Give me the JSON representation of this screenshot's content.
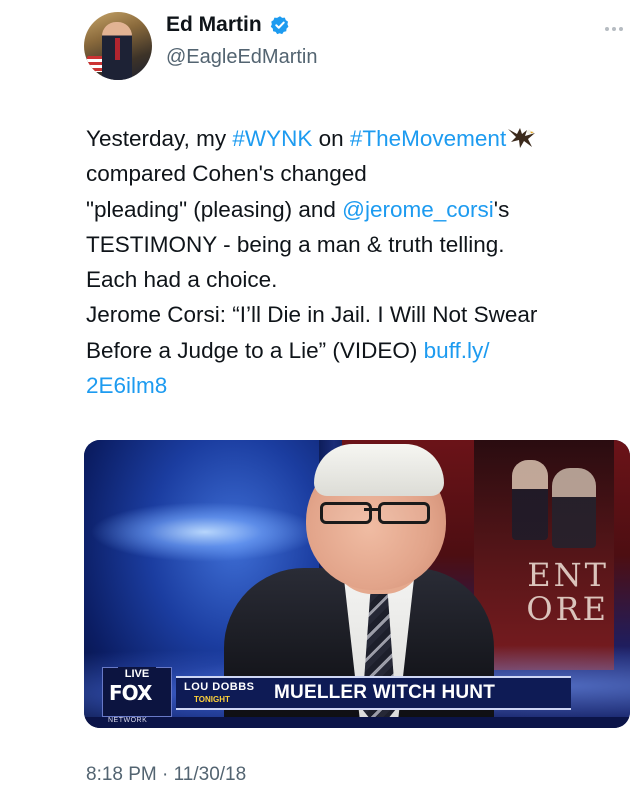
{
  "author": {
    "display_name": "Ed Martin",
    "handle": "@EagleEdMartin",
    "verified": true
  },
  "tweet": {
    "lines": [
      [
        {
          "text": "Yesterday, my "
        },
        {
          "text": "#WYNK",
          "link": true
        },
        {
          "text": " on "
        },
        {
          "text": "#TheMovement",
          "link": true
        }
      ],
      [
        {
          "text": "compared Cohen's changed"
        }
      ],
      [
        {
          "text": "\"pleading\" (pleasing) and "
        },
        {
          "text": "@jerome_corsi",
          "link": true
        },
        {
          "text": "'s"
        }
      ],
      [
        {
          "text": "TESTIMONY - being a man & truth telling."
        }
      ],
      [
        {
          "text": "Each had a choice."
        }
      ],
      [
        {
          "text": "Jerome Corsi: “I’ll Die in Jail. I Will Not Swear"
        }
      ],
      [
        {
          "text": "Before a Judge to a Lie” (VIDEO) "
        },
        {
          "text": "buff.ly/",
          "link": true
        }
      ],
      [
        {
          "text": "2E6ilm8",
          "link": true
        }
      ]
    ],
    "emoji": "eagle"
  },
  "media": {
    "live_label": "LIVE",
    "network_logo": "FOX",
    "network_sub": "NETWORK",
    "show_name": "LOU DOBBS",
    "show_sub": "TONIGHT",
    "headline": "MUELLER WITCH HUNT",
    "poster_text_line1": "ENT",
    "poster_text_line2": "ORE"
  },
  "timestamp": "8:18 PM · 11/30/18",
  "colors": {
    "link": "#1d9bf0",
    "text": "#0f1419",
    "muted": "#536471",
    "verified": "#1d9bf0"
  }
}
